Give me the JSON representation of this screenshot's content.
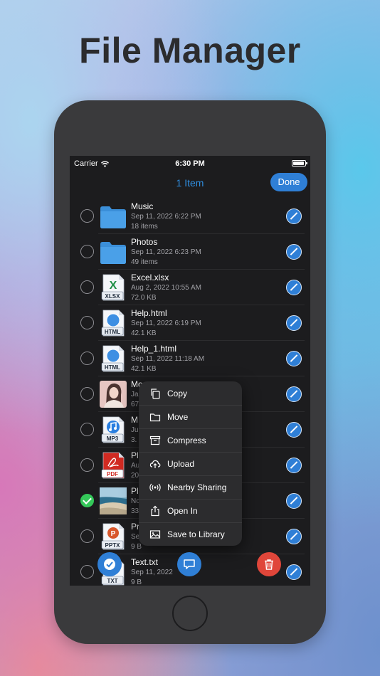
{
  "headline": "File Manager",
  "status": {
    "carrier": "Carrier",
    "time": "6:30 PM"
  },
  "nav": {
    "title": "1 Item",
    "done_label": "Done"
  },
  "files": [
    {
      "name": "Music",
      "date": "Sep 11, 2022 6:22 PM",
      "size": "18 items",
      "icon": "folder-icon",
      "selected": false
    },
    {
      "name": "Photos",
      "date": "Sep 11, 2022 6:23 PM",
      "size": "49 items",
      "icon": "folder-icon",
      "selected": false
    },
    {
      "name": "Excel.xlsx",
      "date": "Aug 2, 2022 10:55 AM",
      "size": "72.0 KB",
      "icon": "xlsx-icon",
      "badge": "XLSX",
      "selected": false
    },
    {
      "name": "Help.html",
      "date": "Sep 11, 2022 6:19 PM",
      "size": "42.1 KB",
      "icon": "html-icon",
      "badge": "HTML",
      "selected": false
    },
    {
      "name": "Help_1.html",
      "date": "Sep 11, 2022 11:18 AM",
      "size": "42.1 KB",
      "icon": "html-icon",
      "badge": "HTML",
      "selected": false
    },
    {
      "name": "Mo",
      "date": "Ja",
      "size": "67",
      "icon": "photo-thumbnail-portrait",
      "selected": false
    },
    {
      "name": "M",
      "date": "Ju",
      "size": "3.",
      "icon": "mp3-icon",
      "badge": "MP3",
      "selected": false
    },
    {
      "name": "Pl",
      "date": "Au",
      "size": "20",
      "icon": "pdf-icon",
      "badge": "PDF",
      "selected": false
    },
    {
      "name": "Pl",
      "date": "No",
      "size": "33",
      "icon": "photo-thumbnail-beach",
      "selected": true
    },
    {
      "name": "Pr",
      "date": "Se",
      "size": "9 B",
      "icon": "pptx-icon",
      "badge": "PPTX",
      "selected": false
    },
    {
      "name": "Text.txt",
      "date": "Sep 11, 2022",
      "size": "9 B",
      "icon": "txt-icon",
      "badge": "TXT",
      "selected": false
    }
  ],
  "context_menu": [
    {
      "label": "Copy",
      "icon": "copy-icon"
    },
    {
      "label": "Move",
      "icon": "folder-icon"
    },
    {
      "label": "Compress",
      "icon": "archive-icon"
    },
    {
      "label": "Upload",
      "icon": "cloud-upload-icon"
    },
    {
      "label": "Nearby Sharing",
      "icon": "nearby-sharing-icon"
    },
    {
      "label": "Open In",
      "icon": "share-icon"
    },
    {
      "label": "Save to Library",
      "icon": "photo-library-icon"
    }
  ],
  "colors": {
    "accent": "#2f7fd6",
    "title_blue": "#2f8ee0",
    "delete_red": "#e0463a",
    "selected_green": "#34c759"
  }
}
